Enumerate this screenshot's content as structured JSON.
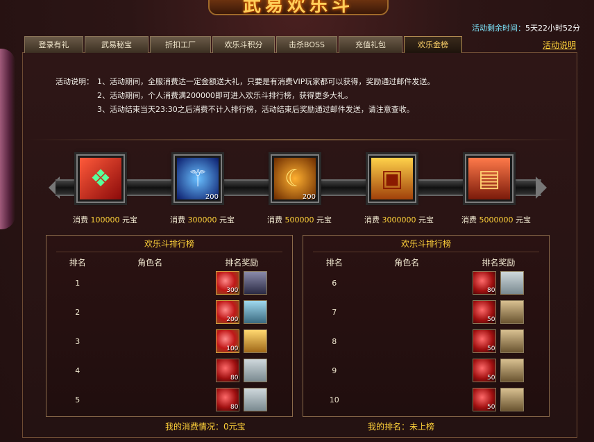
{
  "banner": {
    "title": "武易欢乐斗"
  },
  "top_right": "",
  "timer": {
    "label": "活动剩余时间：",
    "value": "5天22小时52分"
  },
  "help_link": "活动说明",
  "tabs": [
    {
      "label": "登录有礼"
    },
    {
      "label": "武易秘宝"
    },
    {
      "label": "折扣工厂"
    },
    {
      "label": "欢乐斗积分"
    },
    {
      "label": "击杀BOSS"
    },
    {
      "label": "充值礼包"
    },
    {
      "label": "欢乐金榜"
    }
  ],
  "description": {
    "label": "活动说明：",
    "lines": [
      "1、活动期间，全服消费达一定金额送大礼，只要是有消费VIP玩家都可以获得，奖励通过邮件发送。",
      "2、活动期间，个人消费满200000即可进入欢乐斗排行榜，获得更多大礼。",
      "3、活动结束当天23:30之后消费不计入排行榜，活动结束后奖励通过邮件发送，请注意查收。"
    ]
  },
  "milestones": [
    {
      "prefix": "消费",
      "amount": "100000",
      "unit": "元宝",
      "count": "",
      "icon": "red-gift-box-icon"
    },
    {
      "prefix": "消费",
      "amount": "300000",
      "unit": "元宝",
      "count": "200",
      "icon": "blue-drill-icon"
    },
    {
      "prefix": "消费",
      "amount": "500000",
      "unit": "元宝",
      "count": "200",
      "icon": "golden-crescent-icon"
    },
    {
      "prefix": "消费",
      "amount": "3000000",
      "unit": "元宝",
      "count": "",
      "icon": "gold-treasure-chest-icon"
    },
    {
      "prefix": "消费",
      "amount": "5000000",
      "unit": "元宝",
      "count": "",
      "icon": "red-treasure-chest-icon"
    }
  ],
  "rank_left": {
    "title": "欢乐斗排行榜",
    "headers": {
      "rank": "排名",
      "name": "角色名",
      "reward": "排名奖励"
    },
    "rows": [
      {
        "rank": "1",
        "name": "",
        "gem_count": "300",
        "chest": "chest-dark"
      },
      {
        "rank": "2",
        "name": "",
        "gem_count": "200",
        "chest": "chest-blue"
      },
      {
        "rank": "3",
        "name": "",
        "gem_count": "100",
        "chest": "chest-gold"
      },
      {
        "rank": "4",
        "name": "",
        "gem_count": "80",
        "chest": "chest-silver"
      },
      {
        "rank": "5",
        "name": "",
        "gem_count": "80",
        "chest": "chest-silver"
      }
    ]
  },
  "rank_right": {
    "title": "欢乐斗排行榜",
    "headers": {
      "rank": "排名",
      "name": "角色名",
      "reward": "排名奖励"
    },
    "rows": [
      {
        "rank": "6",
        "name": "",
        "gem_count": "80",
        "chest": "chest-silver"
      },
      {
        "rank": "7",
        "name": "",
        "gem_count": "50",
        "chest": "chest-bronze"
      },
      {
        "rank": "8",
        "name": "",
        "gem_count": "50",
        "chest": "chest-bronze"
      },
      {
        "rank": "9",
        "name": "",
        "gem_count": "50",
        "chest": "chest-bronze"
      },
      {
        "rank": "10",
        "name": "",
        "gem_count": "50",
        "chest": "chest-bronze"
      }
    ]
  },
  "footer": {
    "my_spend": "我的消费情况：0元宝",
    "my_rank": "我的排名：未上榜"
  }
}
